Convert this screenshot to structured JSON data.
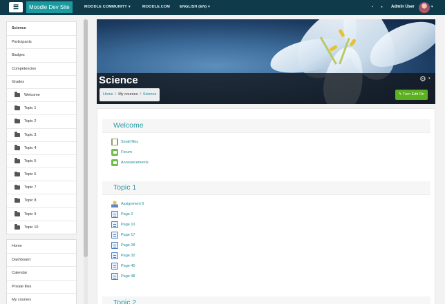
{
  "navbar": {
    "menu_icon": "hamburger-icon",
    "site_name": "Moodle Dev Site",
    "links": [
      "MOODLE COMMUNITY",
      "MOODLE.COM",
      "ENGLISH (EN)"
    ],
    "notification_icon": "bell-icon",
    "messages_icon": "chat-icon",
    "user_name": "Admin User"
  },
  "sidebar": {
    "course_nav": [
      {
        "label": "Science",
        "active": true,
        "icon": ""
      },
      {
        "label": "Participants",
        "icon": ""
      },
      {
        "label": "Badges",
        "icon": ""
      },
      {
        "label": "Competencies",
        "icon": ""
      },
      {
        "label": "Grades",
        "icon": ""
      },
      {
        "label": "Welcome",
        "icon": "folder-icon"
      },
      {
        "label": "Topic 1",
        "icon": "folder-icon"
      },
      {
        "label": "Topic 2",
        "icon": "folder-icon"
      },
      {
        "label": "Topic 3",
        "icon": "folder-icon"
      },
      {
        "label": "Topic 4",
        "icon": "folder-icon"
      },
      {
        "label": "Topic 5",
        "icon": "folder-icon"
      },
      {
        "label": "Topic 6",
        "icon": "folder-icon"
      },
      {
        "label": "Topic 7",
        "icon": "folder-icon"
      },
      {
        "label": "Topic 8",
        "icon": "folder-icon"
      },
      {
        "label": "Topic 9",
        "icon": "folder-icon"
      },
      {
        "label": "Topic 10",
        "icon": "folder-icon"
      }
    ],
    "site_nav": [
      "Home",
      "Dashboard",
      "Calendar",
      "Private files",
      "My courses"
    ]
  },
  "header": {
    "course_title": "Science",
    "breadcrumb": [
      "Home",
      "My courses",
      "Science"
    ],
    "edit_button": "Turn Edit On",
    "settings_icon": "gear-icon"
  },
  "sections": [
    {
      "title": "Welcome",
      "activities": [
        {
          "label": "Small files",
          "icon": "file-icon"
        },
        {
          "label": "Forum",
          "icon": "forum-icon"
        },
        {
          "label": "Announcements",
          "icon": "forum-icon"
        }
      ]
    },
    {
      "title": "Topic 1",
      "activities": [
        {
          "label": "Assignment 6",
          "icon": "assignment-icon"
        },
        {
          "label": "Page 2",
          "icon": "page-icon"
        },
        {
          "label": "Page 10",
          "icon": "page-icon"
        },
        {
          "label": "Page 17",
          "icon": "page-icon"
        },
        {
          "label": "Page 28",
          "icon": "page-icon"
        },
        {
          "label": "Page 32",
          "icon": "page-icon"
        },
        {
          "label": "Page 45",
          "icon": "page-icon"
        },
        {
          "label": "Page 48",
          "icon": "page-icon"
        }
      ]
    },
    {
      "title": "Topic 2",
      "activities": []
    }
  ],
  "colors": {
    "navbar": "#0f3a4a",
    "brand": "#1b9aa0",
    "link": "#1b8a93",
    "section_title": "#2a9aa5",
    "edit_button": "#5db020"
  }
}
